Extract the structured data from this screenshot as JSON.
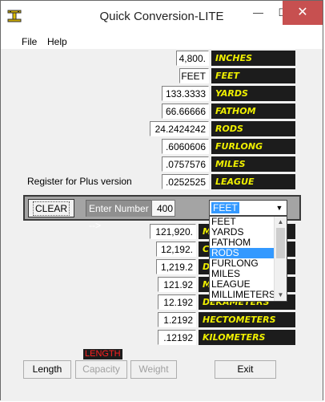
{
  "window": {
    "title": "Quick Conversion-LITE",
    "controls": {
      "minimize": "—",
      "maximize": "☐",
      "close": "✕"
    }
  },
  "menu": [
    "File",
    "Help"
  ],
  "top_rows": [
    {
      "value": "4,800.",
      "unit": "INCHES"
    },
    {
      "value": "FEET",
      "unit": "FEET"
    },
    {
      "value": "133.3333",
      "unit": "YARDS"
    },
    {
      "value": "66.66666",
      "unit": "FATHOM"
    },
    {
      "value": "24.2424242",
      "unit": "RODS"
    },
    {
      "value": ".6060606",
      "unit": "FURLONG"
    },
    {
      "value": ".0757576",
      "unit": "MILES"
    },
    {
      "value": ".0252525",
      "unit": "LEAGUE"
    }
  ],
  "register_text": "Register for Plus version",
  "input_panel": {
    "clear_label": "CLEAR",
    "enter_label": "Enter Number -->",
    "number_value": "400",
    "selected_unit": "FEET",
    "dropdown_arrow": "▼"
  },
  "dropdown_options": [
    "FEET",
    "YARDS",
    "FATHOM",
    "RODS",
    "FURLONG",
    "MILES",
    "LEAGUE",
    "MILLIMETERS"
  ],
  "dropdown_highlighted": "RODS",
  "bottom_rows": [
    {
      "value": "121,920.",
      "unit": "M"
    },
    {
      "value": "12,192.",
      "unit": "C"
    },
    {
      "value": "1,219.2",
      "unit": "D"
    },
    {
      "value": "121.92",
      "unit": "M"
    },
    {
      "value": "12.192",
      "unit": "DEKAMETERS"
    },
    {
      "value": "1.2192",
      "unit": "HECTOMETERS"
    },
    {
      "value": ".12192",
      "unit": "KILOMETERS"
    }
  ],
  "category_label": "LENGTH",
  "buttons": {
    "length": "Length",
    "capacity": "Capacity",
    "weight": "Weight",
    "exit": "Exit"
  },
  "colors": {
    "unit_bg": "#1c1c1c",
    "unit_text": "#f0f000",
    "close_button": "#c75050",
    "highlight": "#3399ff",
    "category_text": "#ff2020"
  }
}
